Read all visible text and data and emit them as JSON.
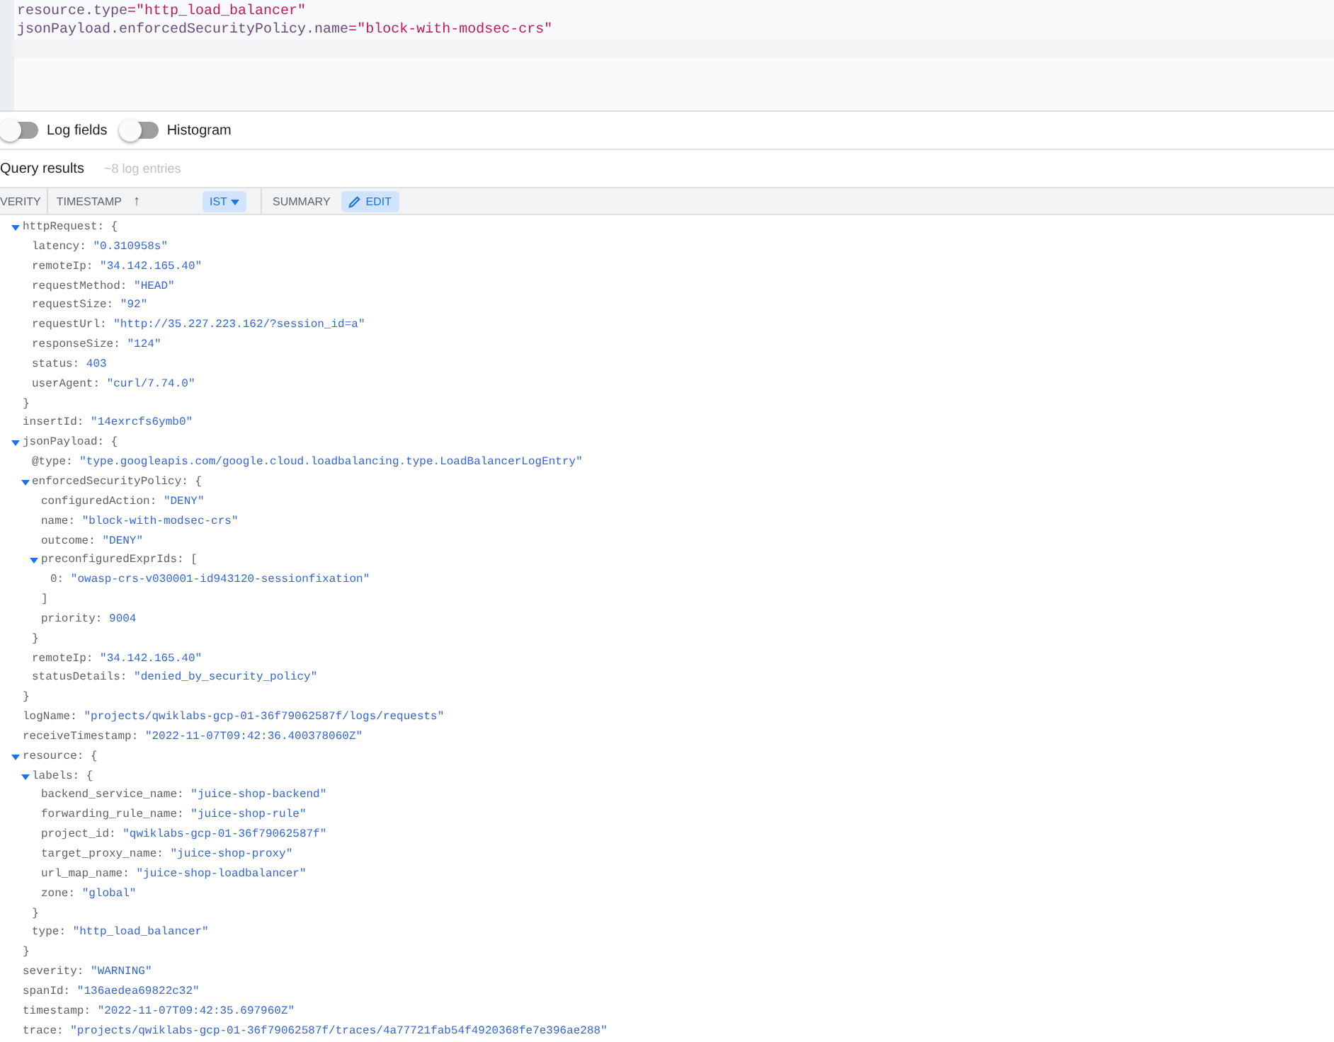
{
  "query_editor": {
    "lines": [
      {
        "field": "resource.type",
        "operator": "=",
        "value": "\"http_load_balancer\""
      },
      {
        "field": "jsonPayload.enforcedSecurityPolicy.name",
        "operator": "=",
        "value": "\"block-with-modsec-crs\""
      }
    ]
  },
  "toggles": [
    {
      "label": "Log fields",
      "on": false
    },
    {
      "label": "Histogram",
      "on": false
    }
  ],
  "results": {
    "title": "Query results",
    "count": "~8 log entries"
  },
  "columns": {
    "severity": "VERITY",
    "timestamp": "TIMESTAMP",
    "sort_arrow": "↑",
    "timezone": "IST",
    "summary": "SUMMARY",
    "edit": "EDIT"
  },
  "entry": [
    {
      "key": "httpRequest:",
      "open": "{",
      "close": "}",
      "expanded": true,
      "children": [
        {
          "key": "latency:",
          "value": "\"0.310958s\""
        },
        {
          "key": "remoteIp:",
          "value": "\"34.142.165.40\""
        },
        {
          "key": "requestMethod:",
          "value": "\"HEAD\""
        },
        {
          "key": "requestSize:",
          "value": "\"92\""
        },
        {
          "key": "requestUrl:",
          "value": "\"http://35.227.223.162/?session_id=a\""
        },
        {
          "key": "responseSize:",
          "value": "\"124\""
        },
        {
          "key": "status:",
          "value": "403"
        },
        {
          "key": "userAgent:",
          "value": "\"curl/7.74.0\""
        }
      ]
    },
    {
      "key": "insertId:",
      "value": "\"14exrcfs6ymb0\""
    },
    {
      "key": "jsonPayload:",
      "open": "{",
      "close": "}",
      "expanded": true,
      "children": [
        {
          "key": "@type:",
          "value": "\"type.googleapis.com/google.cloud.loadbalancing.type.LoadBalancerLogEntry\""
        },
        {
          "key": "enforcedSecurityPolicy:",
          "open": "{",
          "close": "}",
          "expanded": true,
          "children": [
            {
              "key": "configuredAction:",
              "value": "\"DENY\""
            },
            {
              "key": "name:",
              "value": "\"block-with-modsec-crs\""
            },
            {
              "key": "outcome:",
              "value": "\"DENY\""
            },
            {
              "key": "preconfiguredExprIds:",
              "open": "[",
              "close": "]",
              "expanded": true,
              "children": [
                {
                  "key": "0:",
                  "value": "\"owasp-crs-v030001-id943120-sessionfixation\""
                }
              ]
            },
            {
              "key": "priority:",
              "value": "9004"
            }
          ]
        },
        {
          "key": "remoteIp:",
          "value": "\"34.142.165.40\""
        },
        {
          "key": "statusDetails:",
          "value": "\"denied_by_security_policy\""
        }
      ]
    },
    {
      "key": "logName:",
      "value": "\"projects/qwiklabs-gcp-01-36f79062587f/logs/requests\""
    },
    {
      "key": "receiveTimestamp:",
      "value": "\"2022-11-07T09:42:36.400378060Z\""
    },
    {
      "key": "resource:",
      "open": "{",
      "close": "}",
      "expanded": true,
      "children": [
        {
          "key": "labels:",
          "open": "{",
          "close": "}",
          "expanded": true,
          "children": [
            {
              "key": "backend_service_name:",
              "value": "\"juice-shop-backend\""
            },
            {
              "key": "forwarding_rule_name:",
              "value": "\"juice-shop-rule\""
            },
            {
              "key": "project_id:",
              "value": "\"qwiklabs-gcp-01-36f79062587f\""
            },
            {
              "key": "target_proxy_name:",
              "value": "\"juice-shop-proxy\""
            },
            {
              "key": "url_map_name:",
              "value": "\"juice-shop-loadbalancer\""
            },
            {
              "key": "zone:",
              "value": "\"global\""
            }
          ]
        },
        {
          "key": "type:",
          "value": "\"http_load_balancer\""
        }
      ]
    },
    {
      "key": "severity:",
      "value": "\"WARNING\""
    },
    {
      "key": "spanId:",
      "value": "\"136aedea69822c32\""
    },
    {
      "key": "timestamp:",
      "value": "\"2022-11-07T09:42:35.697960Z\""
    },
    {
      "key": "trace:",
      "value": "\"projects/qwiklabs-gcp-01-36f79062587f/traces/4a77721fab54f4920368fe7e396ae288\""
    }
  ]
}
